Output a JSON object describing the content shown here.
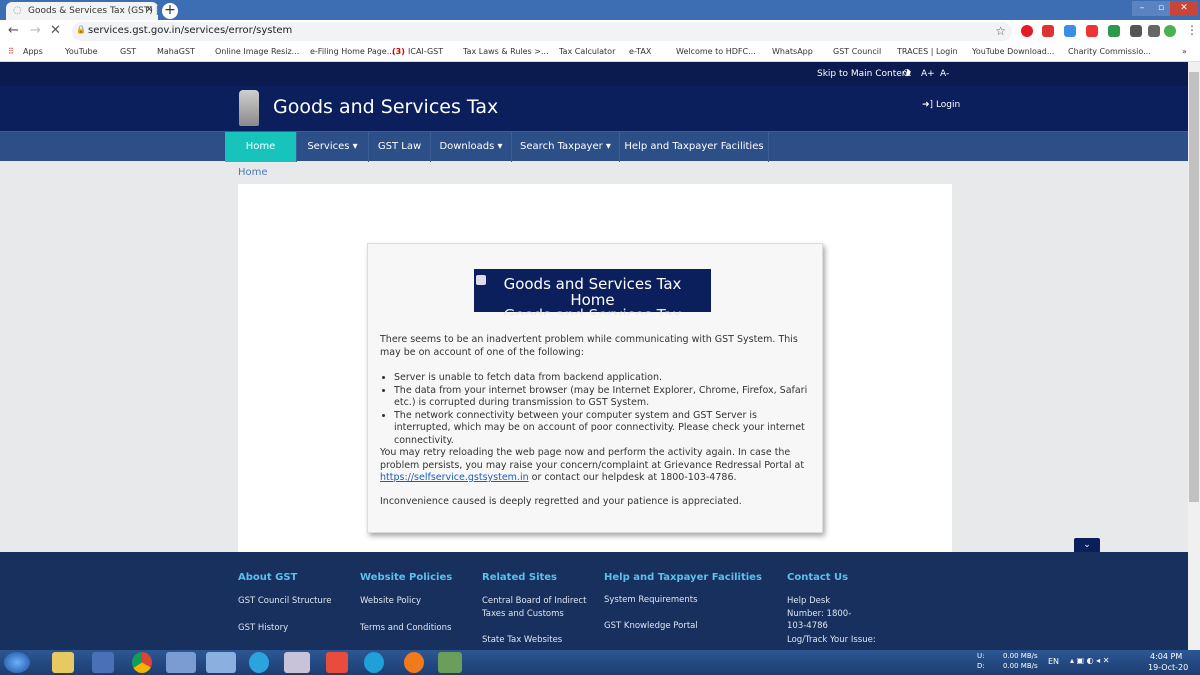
{
  "browser": {
    "tab_title": "Goods & Services Tax (GST) | Sys",
    "url": "services.gst.gov.in/services/error/system",
    "bookmarks": [
      "Apps",
      "YouTube",
      "GST",
      "MahaGST",
      "Online Image Resiz...",
      "e-Filing Home Page...",
      "ICAI-GST",
      "Tax Laws & Rules >...",
      "Tax Calculator",
      "e-TAX",
      "Welcome to HDFC...",
      "WhatsApp",
      "GST Council",
      "TRACES | Login",
      "YouTube Download...",
      "Charity Commissio..."
    ],
    "bookmark_more": "»"
  },
  "site": {
    "skip": "Skip to Main Content",
    "contrast": "◑",
    "font_up": "A+",
    "font_down": "A-",
    "title": "Goods and Services Tax",
    "login": "Login",
    "nav": [
      "Home",
      "Services",
      "GST Law",
      "Downloads",
      "Search Taxpayer",
      "Help and Taxpayer Facilities"
    ],
    "breadcrumb": "Home"
  },
  "error": {
    "logo_alt_1": "Goods and Services Tax",
    "logo_alt_2": "Home",
    "logo_alt_3": "Goods and Services Tax",
    "intro": "There seems to be an inadvertent problem while communicating with GST System. This may be on account of one of the following:",
    "reasons": [
      "Server is unable to fetch data from backend application.",
      "The data from your internet browser (may be Internet Explorer, Chrome, Firefox, Safari etc.) is corrupted during transmission to GST System.",
      "The network connectivity between your computer system and GST Server is interrupted, which may be on account of poor connectivity. Please check your internet connectivity."
    ],
    "retry_1": "You may retry reloading the web page now and perform the activity again. In case the problem persists, you may raise your concern/complaint at Grievance Redressal Portal at ",
    "retry_link": "https://selfservice.gstsystem.in",
    "retry_2": " or contact our helpdesk at 1800-103-4786.",
    "regret": "Inconvenience caused is deeply regretted and your patience is appreciated."
  },
  "footer": {
    "cols": [
      {
        "title": "About GST",
        "items": [
          "GST Council Structure",
          "GST History"
        ]
      },
      {
        "title": "Website Policies",
        "items": [
          "Website Policy",
          "Terms and Conditions"
        ]
      },
      {
        "title": "Related Sites",
        "items": [
          "Central Board of Indirect Taxes and Customs",
          "State Tax Websites"
        ]
      },
      {
        "title": "Help and Taxpayer Facilities",
        "items": [
          "System Requirements",
          "GST Knowledge Portal"
        ]
      },
      {
        "title": "Contact Us",
        "items": [
          "Help Desk Number: 1800-103-4786",
          "Log/Track Your Issue:"
        ]
      }
    ]
  },
  "taskbar": {
    "net_u": "U:",
    "net_u_val": "0.00 MB/s",
    "net_d": "D:",
    "net_d_val": "0.00 MB/s",
    "lang": "EN",
    "time": "4:04 PM",
    "date": "19-Oct-20"
  },
  "colors": {
    "header": "#0c1f5d",
    "nav": "#2c4f87",
    "home_active": "#17c4bb",
    "footer": "#17305e",
    "footer_heading": "#5bc0eb"
  }
}
